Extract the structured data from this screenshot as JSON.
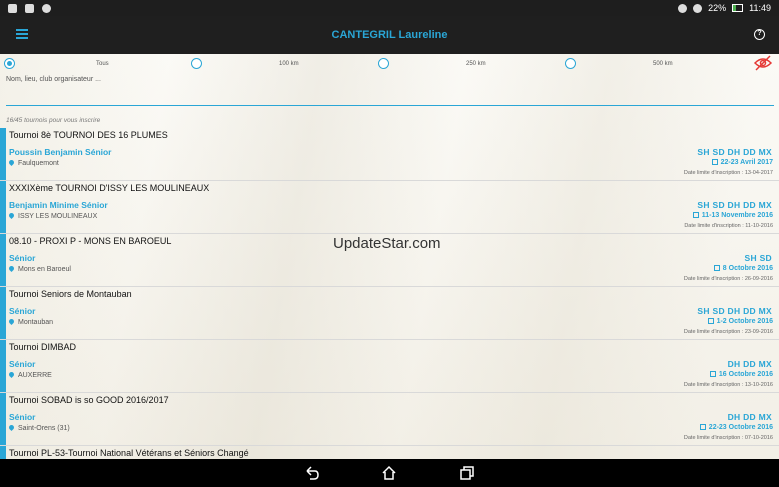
{
  "status": {
    "battery": "22%",
    "time": "11:49"
  },
  "header": {
    "title": "CANTEGRIL Laureline"
  },
  "filters": [
    {
      "label": "Tous",
      "checked": true
    },
    {
      "label": "100 km",
      "checked": false
    },
    {
      "label": "250 km",
      "checked": false
    },
    {
      "label": "500 km",
      "checked": false
    }
  ],
  "search": {
    "placeholder": "Nom, lieu, club organisateur ..."
  },
  "count_text": "16/45 tournois pour vous inscrire",
  "tournaments": [
    {
      "name": "Tournoi 8è TOURNOI DES 16 PLUMES",
      "categories": "Poussin Benjamin Sénior",
      "location": "Faulquemont",
      "events": "SH SD DH DD MX",
      "dates": "22-23 Avril 2017",
      "limit": "Date limite d'inscription : 13-04-2017"
    },
    {
      "name": "XXXIXème TOURNOI D'ISSY LES MOULINEAUX",
      "categories": "Benjamin Minime Sénior",
      "location": "ISSY LES MOULINEAUX",
      "events": "SH SD DH DD MX",
      "dates": "11-13 Novembre 2016",
      "limit": "Date limite d'inscription : 11-10-2016"
    },
    {
      "name": "08.10 - PROXI  P - MONS EN BAROEUL",
      "categories": "Sénior",
      "location": "Mons en Baroeul",
      "events": "SH SD",
      "dates": "8 Octobre 2016",
      "limit": "Date limite d'inscription : 26-09-2016"
    },
    {
      "name": "Tournoi Seniors de Montauban",
      "categories": "Sénior",
      "location": "Montauban",
      "events": "SH SD DH DD MX",
      "dates": "1-2 Octobre 2016",
      "limit": "Date limite d'inscription : 23-09-2016"
    },
    {
      "name": "Tournoi DIMBAD",
      "categories": "Sénior",
      "location": "AUXERRE",
      "events": "DH DD MX",
      "dates": "16 Octobre 2016",
      "limit": "Date limite d'inscription : 13-10-2016"
    },
    {
      "name": "Tournoi SOBAD is so GOOD 2016/2017",
      "categories": "Sénior",
      "location": "Saint-Orens (31)",
      "events": "DH DD MX",
      "dates": "22-23 Octobre 2016",
      "limit": "Date limite d'inscription : 07-10-2016"
    },
    {
      "name": "Tournoi PL-53-Tournoi National Vétérans et Séniors Changé",
      "categories": "",
      "location": "",
      "events": "",
      "dates": "",
      "limit": ""
    }
  ],
  "watermark": "UpdateStar.com",
  "colors": {
    "accent": "#2aa6d6",
    "appbar": "#1f1f1f"
  },
  "icons": {
    "menu": "menu-icon",
    "help": "help-icon",
    "eye_off": "eye-off-icon",
    "back": "back-icon",
    "home": "home-icon",
    "recents": "recents-icon"
  }
}
